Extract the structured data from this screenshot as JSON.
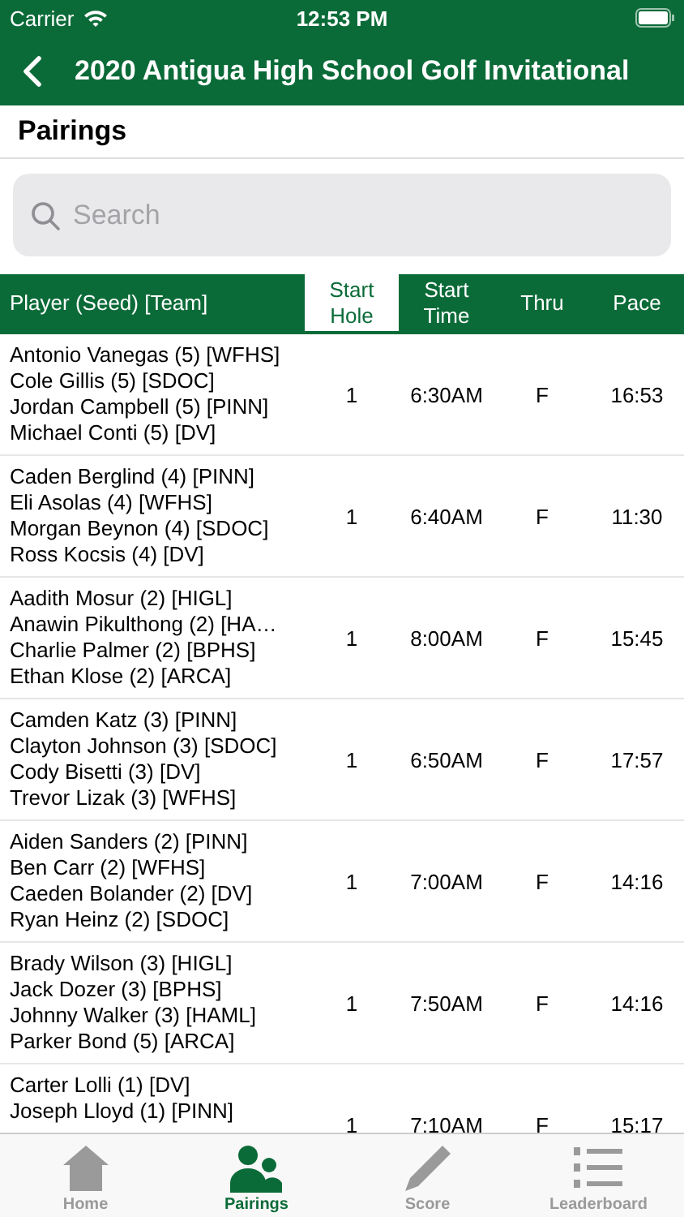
{
  "status_bar": {
    "carrier": "Carrier",
    "time": "12:53 PM"
  },
  "nav_bar": {
    "title": "2020 Antigua High School Golf Invitational"
  },
  "section_title": "Pairings",
  "search": {
    "placeholder": "Search"
  },
  "table": {
    "columns": [
      {
        "label": "Player (Seed) [Team]",
        "selected": false
      },
      {
        "label": "Start Hole",
        "selected": true
      },
      {
        "label": "Start Time",
        "selected": false
      },
      {
        "label": "Thru",
        "selected": false
      },
      {
        "label": "Pace",
        "selected": false
      }
    ],
    "rows": [
      {
        "players": [
          "Antonio Vanegas (5) [WFHS]",
          "Cole Gillis (5) [SDOC]",
          "Jordan Campbell (5) [PINN]",
          "Michael Conti (5) [DV]"
        ],
        "start_hole": "1",
        "start_time": "6:30AM",
        "thru": "F",
        "pace": "16:53"
      },
      {
        "players": [
          "Caden Berglind (4) [PINN]",
          "Eli Asolas (4) [WFHS]",
          "Morgan Beynon (4) [SDOC]",
          "Ross Kocsis (4) [DV]"
        ],
        "start_hole": "1",
        "start_time": "6:40AM",
        "thru": "F",
        "pace": "11:30"
      },
      {
        "players": [
          "Aadith Mosur (2) [HIGL]",
          "Anawin Pikulthong (2) [HA…",
          "Charlie Palmer (2) [BPHS]",
          "Ethan Klose (2) [ARCA]"
        ],
        "start_hole": "1",
        "start_time": "8:00AM",
        "thru": "F",
        "pace": "15:45"
      },
      {
        "players": [
          "Camden Katz (3) [PINN]",
          "Clayton Johnson (3) [SDOC]",
          "Cody Bisetti (3) [DV]",
          "Trevor Lizak (3) [WFHS]"
        ],
        "start_hole": "1",
        "start_time": "6:50AM",
        "thru": "F",
        "pace": "17:57"
      },
      {
        "players": [
          "Aiden Sanders (2) [PINN]",
          "Ben Carr (2) [WFHS]",
          "Caeden Bolander (2) [DV]",
          "Ryan Heinz (2) [SDOC]"
        ],
        "start_hole": "1",
        "start_time": "7:00AM",
        "thru": "F",
        "pace": "14:16"
      },
      {
        "players": [
          "Brady Wilson (3) [HIGL]",
          "Jack Dozer (3) [BPHS]",
          "Johnny Walker (3) [HAML]",
          "Parker Bond (5) [ARCA]"
        ],
        "start_hole": "1",
        "start_time": "7:50AM",
        "thru": "F",
        "pace": "14:16"
      },
      {
        "players": [
          "Carter Lolli (1) [DV]",
          "Joseph Lloyd (1) [PINN]"
        ],
        "start_hole": "1",
        "start_time": "7:10AM",
        "thru": "F",
        "pace": "15:17"
      }
    ]
  },
  "tab_bar": [
    {
      "label": "Home",
      "kind": "home",
      "selected": false
    },
    {
      "label": "Pairings",
      "kind": "people",
      "selected": true
    },
    {
      "label": "Score",
      "kind": "pencil",
      "selected": false
    },
    {
      "label": "Leaderboard",
      "kind": "list",
      "selected": false
    }
  ]
}
